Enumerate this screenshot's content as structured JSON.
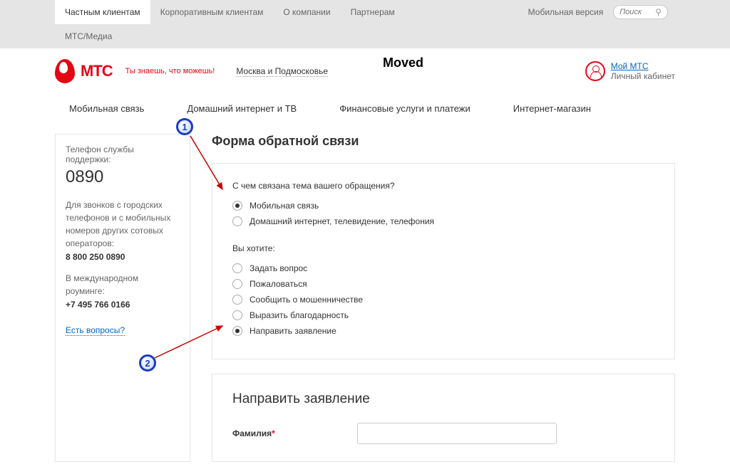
{
  "topnav": {
    "items": [
      "Частным клиентам",
      "Корпоративным клиентам",
      "О компании",
      "Партнерам"
    ],
    "row2": "МТС/Медиа",
    "mobile": "Мобильная версия",
    "search_placeholder": "Поиск"
  },
  "header": {
    "logo": "МТС",
    "slogan": "Ты знаешь, что можешь!",
    "region": "Москва и Подмосковье",
    "moved": "Moved",
    "myMts": "Мой МТС",
    "cabinet": "Личный кабинет"
  },
  "mainnav": [
    "Мобильная связь",
    "Домашний интернет и ТВ",
    "Финансовые услуги и платежи",
    "Интернет-магазин"
  ],
  "sidebar": {
    "label": "Телефон службы поддержки:",
    "phone": "0890",
    "text1": "Для звонков с городских телефонов и с мобильных номеров других сотовых операторов:",
    "num1": "8 800 250 0890",
    "text2": "В международном роуминге:",
    "num2": "+7 495 766 0166",
    "link": "Есть вопросы?"
  },
  "form": {
    "title": "Форма обратной связи",
    "q1": "С чем связана тема вашего обращения?",
    "topic": [
      {
        "label": "Мобильная связь",
        "checked": true
      },
      {
        "label": "Домашний интернет, телевидение, телефония",
        "checked": false
      }
    ],
    "q2": "Вы хотите:",
    "want": [
      {
        "label": "Задать вопрос",
        "checked": false
      },
      {
        "label": "Пожаловаться",
        "checked": false
      },
      {
        "label": "Сообщить о мошенничестве",
        "checked": false
      },
      {
        "label": "Выразить благодарность",
        "checked": false
      },
      {
        "label": "Направить заявление",
        "checked": true
      }
    ],
    "title2": "Направить заявление",
    "surname_label": "Фамилия",
    "req": "*"
  },
  "annot": {
    "n1": "1",
    "n2": "2"
  }
}
